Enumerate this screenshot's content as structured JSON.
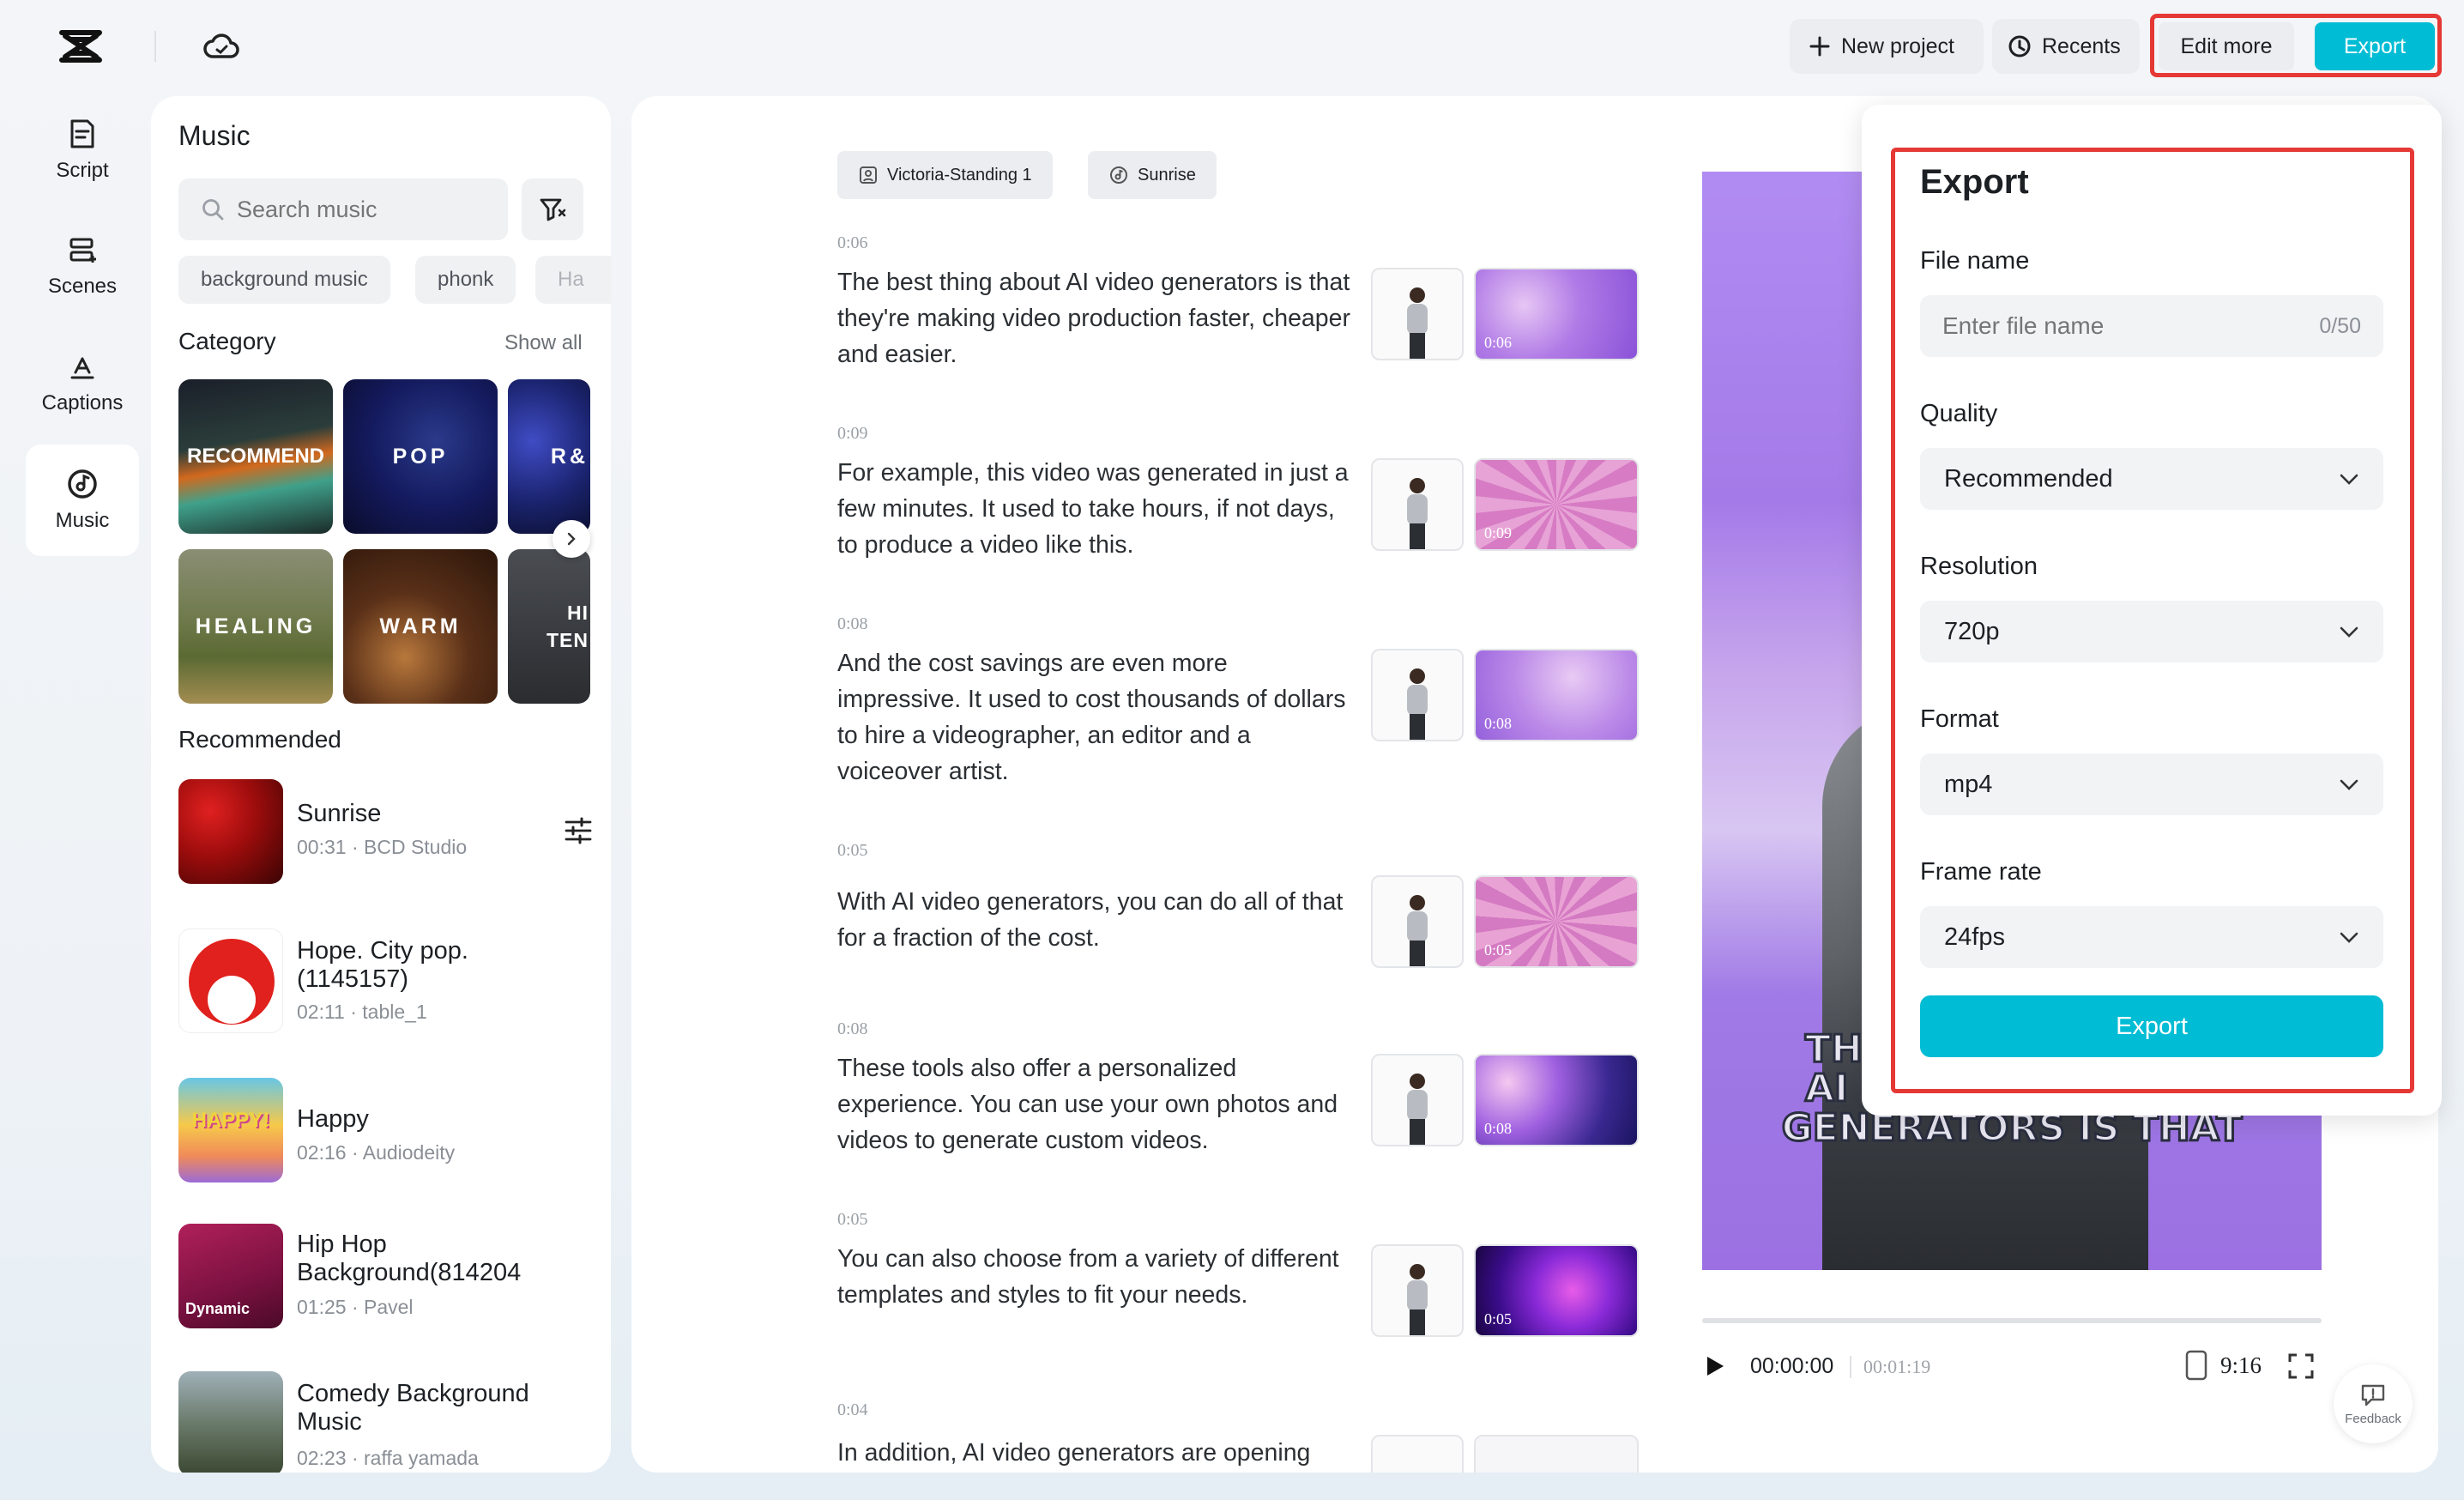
{
  "topbar": {
    "new_project": "New project",
    "recents": "Recents",
    "edit_more": "Edit more",
    "export": "Export"
  },
  "nav": [
    {
      "label": "Script",
      "icon": "script-icon"
    },
    {
      "label": "Scenes",
      "icon": "scenes-icon"
    },
    {
      "label": "Captions",
      "icon": "captions-icon"
    },
    {
      "label": "Music",
      "icon": "music-icon",
      "active": true
    }
  ],
  "music": {
    "title": "Music",
    "search_placeholder": "Search music",
    "chips": [
      "background music",
      "phonk",
      "Ha"
    ],
    "category_title": "Category",
    "show_all": "Show all",
    "categories": [
      "RECOMMEND",
      "POP",
      "R&",
      "HEALING",
      "WARM",
      "HI TEN"
    ],
    "recommended_title": "Recommended",
    "tracks": [
      {
        "name": "Sunrise",
        "meta": "00:31 · BCD Studio"
      },
      {
        "name": "Hope. City pop. (1145157)",
        "meta": "02:11 · table_1"
      },
      {
        "name": "Happy",
        "meta": "02:16 · Audiodeity",
        "thumb_text": "HAPPY!"
      },
      {
        "name": "Hip Hop Background(814204",
        "meta": "01:25 · Pavel",
        "thumb_text": "Dynamic"
      },
      {
        "name": "Comedy Background Music",
        "meta": "02:23 · raffa yamada"
      }
    ]
  },
  "script": {
    "avatar_tag": "Victoria-Standing 1",
    "music_tag": "Sunrise",
    "scenes": [
      {
        "time": "0:06",
        "text": "The best thing about AI video generators is that they're making video production faster, cheaper and easier."
      },
      {
        "time": "0:09",
        "text": "For example, this video was generated in just a few minutes. It used to take hours, if not days, to produce a video like this."
      },
      {
        "time": "0:08",
        "text": "And the cost savings are even more impressive. It used to cost thousands of dollars to hire a videographer, an editor and a voiceover artist."
      },
      {
        "time": "0:05",
        "text": "With AI video generators, you can do all of that for a fraction of the cost."
      },
      {
        "time": "0:08",
        "text": "These tools also offer a personalized experience. You can use your own photos and videos to generate custom videos."
      },
      {
        "time": "0:05",
        "text": "You can also choose from a variety of different templates and styles to fit your needs."
      },
      {
        "time": "0:04",
        "text": "In addition, AI video generators are opening"
      }
    ]
  },
  "preview": {
    "caption_line1": "TH",
    "caption_line2": "AI",
    "caption_line3": "GENERATORS IS THAT",
    "current_time": "00:00:00",
    "total_time": "00:01:19",
    "aspect": "9:16",
    "feedback": "Feedback"
  },
  "export_panel": {
    "title": "Export",
    "file_name_label": "File name",
    "file_name_placeholder": "Enter file name",
    "file_name_count": "0/50",
    "quality_label": "Quality",
    "quality_value": "Recommended",
    "resolution_label": "Resolution",
    "resolution_value": "720p",
    "format_label": "Format",
    "format_value": "mp4",
    "framerate_label": "Frame rate",
    "framerate_value": "24fps",
    "export_button": "Export"
  },
  "colors": {
    "accent": "#00bcd4",
    "highlight_border": "#e53935"
  }
}
